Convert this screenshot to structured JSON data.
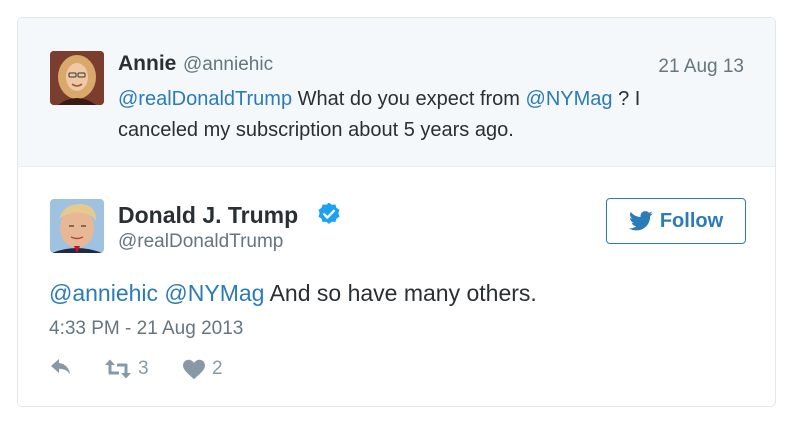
{
  "parent_tweet": {
    "name": "Annie",
    "handle": "@anniehic",
    "date": "21 Aug 13",
    "text_parts": {
      "mention1": "@realDonaldTrump",
      "t1": " What do you expect from ",
      "mention2": "@NYMag",
      "t2": " ? I canceled my subscription about 5 years ago."
    }
  },
  "tweet": {
    "name": "Donald J. Trump",
    "handle": "@realDonaldTrump",
    "follow_label": "Follow",
    "text_parts": {
      "mention1": "@anniehic",
      "mention2": "@NYMag",
      "t1": " And so have many others."
    },
    "timestamp": "4:33 PM - 21 Aug 2013",
    "retweets": "3",
    "likes": "2"
  },
  "icons": {
    "verified": "verified-badge-icon",
    "follow": "twitter-bird-icon",
    "reply": "reply-icon",
    "retweet": "retweet-icon",
    "like": "heart-icon"
  },
  "colors": {
    "link": "#2b7bb9",
    "verified": "#1da1f2",
    "muted": "#66757f",
    "action": "#8899a6",
    "parent_bg": "#f5f8fa"
  }
}
